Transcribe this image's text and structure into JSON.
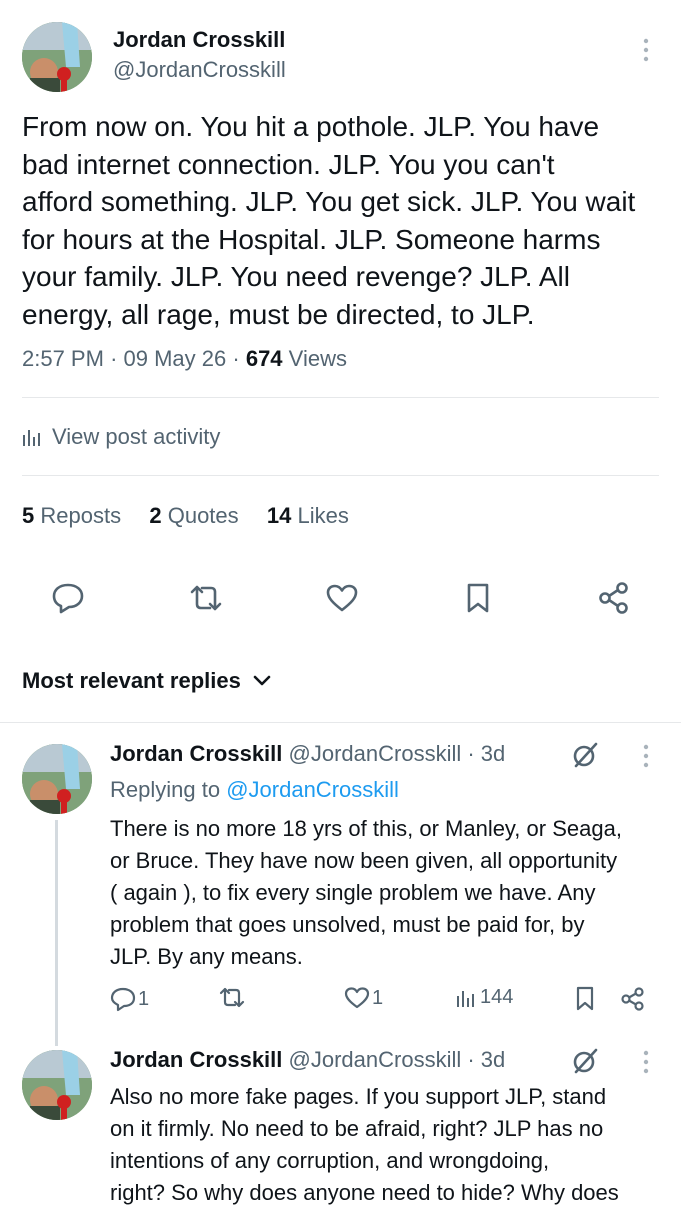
{
  "post": {
    "author_name": "Jordan Crosskill",
    "author_handle": "@JordanCrosskill",
    "text_lines": [
      "From now on. You hit a pothole. JLP. You have",
      "bad internet connection. JLP. You you can't",
      "afford something. JLP. You get sick. JLP. You wait",
      "for hours at the Hospital. JLP. Someone harms",
      "your family. JLP. You need revenge? JLP. All",
      "energy, all rage, must be directed, to JLP."
    ],
    "time": "2:57 PM",
    "date": "09 May 26",
    "views_count": "674",
    "views_label": "Views",
    "separator": "·",
    "view_activity": "View post activity",
    "reposts_count": "5",
    "reposts_label": "Reposts",
    "quotes_count": "2",
    "quotes_label": "Quotes",
    "likes_count": "14",
    "likes_label": "Likes"
  },
  "replies_header": "Most relevant replies",
  "replies": [
    {
      "author_name": "Jordan Crosskill",
      "author_handle": "@JordanCrosskill",
      "age": "· 3d",
      "replying_prefix": "Replying to",
      "replying_handle": "@JordanCrosskill",
      "text_lines": [
        "There is no more 18 yrs of this, or Manley, or Seaga,",
        "or Bruce. They have now been given, all opportunity",
        "( again ), to fix every single problem we have. Any",
        "problem that goes unsolved, must be paid for, by",
        "JLP. By any means."
      ],
      "reply_count": "1",
      "repost_count": "",
      "like_count": "1",
      "views": "144"
    },
    {
      "author_name": "Jordan Crosskill",
      "author_handle": "@JordanCrosskill",
      "age": "· 3d",
      "text_lines": [
        "Also no more fake pages. If you support JLP, stand",
        "on it firmly. No need to be afraid, right? JLP has no",
        "intentions of any corruption, and wrongdoing,",
        "right? So why does anyone need to hide? Why does"
      ]
    }
  ],
  "colors": {
    "text": "#0f1419",
    "muted": "#536471",
    "link": "#1d9bf0",
    "divider": "#e6e8ea"
  }
}
